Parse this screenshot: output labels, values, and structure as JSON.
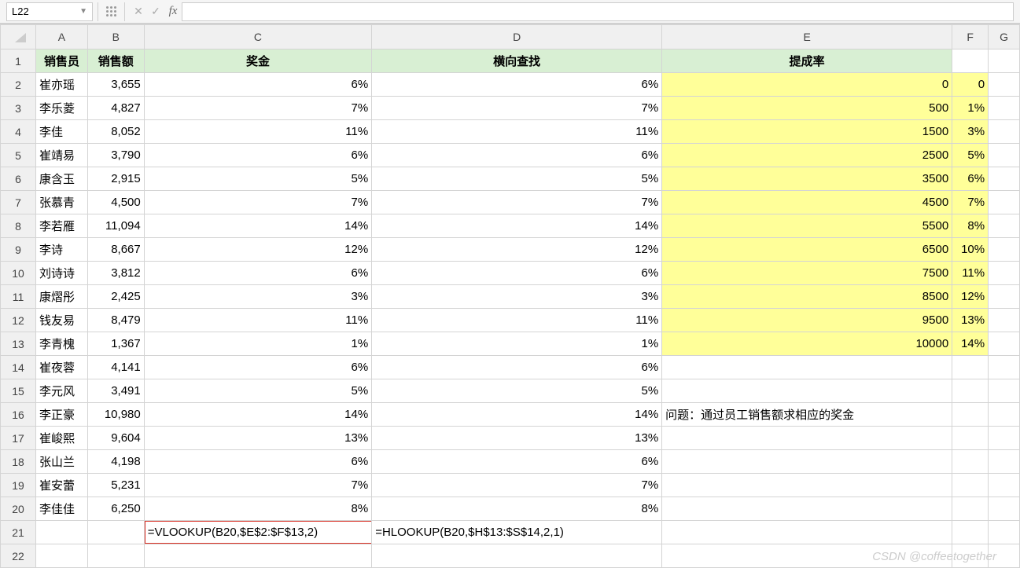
{
  "formula_bar": {
    "cell_ref": "L22",
    "formula": ""
  },
  "headers": {
    "A": "销售员",
    "B": "销售额",
    "C": "奖金",
    "D": "横向查找",
    "E": "提成率"
  },
  "rows": [
    {
      "name": "崔亦瑶",
      "sales": "3,655",
      "bonus": "6%",
      "hv": "6%",
      "e": "0",
      "f": "0"
    },
    {
      "name": "李乐菱",
      "sales": "4,827",
      "bonus": "7%",
      "hv": "7%",
      "e": "500",
      "f": "1%"
    },
    {
      "name": "李佳",
      "sales": "8,052",
      "bonus": "11%",
      "hv": "11%",
      "e": "1500",
      "f": "3%"
    },
    {
      "name": "崔靖易",
      "sales": "3,790",
      "bonus": "6%",
      "hv": "6%",
      "e": "2500",
      "f": "5%"
    },
    {
      "name": "康含玉",
      "sales": "2,915",
      "bonus": "5%",
      "hv": "5%",
      "e": "3500",
      "f": "6%"
    },
    {
      "name": "张慕青",
      "sales": "4,500",
      "bonus": "7%",
      "hv": "7%",
      "e": "4500",
      "f": "7%"
    },
    {
      "name": "李若雁",
      "sales": "11,094",
      "bonus": "14%",
      "hv": "14%",
      "e": "5500",
      "f": "8%"
    },
    {
      "name": "李诗",
      "sales": "8,667",
      "bonus": "12%",
      "hv": "12%",
      "e": "6500",
      "f": "10%"
    },
    {
      "name": "刘诗诗",
      "sales": "3,812",
      "bonus": "6%",
      "hv": "6%",
      "e": "7500",
      "f": "11%"
    },
    {
      "name": "康熠彤",
      "sales": "2,425",
      "bonus": "3%",
      "hv": "3%",
      "e": "8500",
      "f": "12%"
    },
    {
      "name": "钱友易",
      "sales": "8,479",
      "bonus": "11%",
      "hv": "11%",
      "e": "9500",
      "f": "13%"
    },
    {
      "name": "李青槐",
      "sales": "1,367",
      "bonus": "1%",
      "hv": "1%",
      "e": "10000",
      "f": "14%"
    },
    {
      "name": "崔夜蓉",
      "sales": "4,141",
      "bonus": "6%",
      "hv": "6%",
      "e": "",
      "f": ""
    },
    {
      "name": "李元风",
      "sales": "3,491",
      "bonus": "5%",
      "hv": "5%",
      "e": "",
      "f": ""
    },
    {
      "name": "李正豪",
      "sales": "10,980",
      "bonus": "14%",
      "hv": "14%",
      "e": "问题：通过员工销售额求相应的奖金",
      "f": ""
    },
    {
      "name": "崔峻熙",
      "sales": "9,604",
      "bonus": "13%",
      "hv": "13%",
      "e": "",
      "f": ""
    },
    {
      "name": "张山兰",
      "sales": "4,198",
      "bonus": "6%",
      "hv": "6%",
      "e": "",
      "f": ""
    },
    {
      "name": "崔安蕾",
      "sales": "5,231",
      "bonus": "7%",
      "hv": "7%",
      "e": "",
      "f": ""
    },
    {
      "name": "李佳佳",
      "sales": "6,250",
      "bonus": "8%",
      "hv": "8%",
      "e": "",
      "f": ""
    }
  ],
  "formula_row": {
    "c": "=VLOOKUP(B20,$E$2:$F$13,2)",
    "d": "=HLOOKUP(B20,$H$13:$S$14,2,1)"
  },
  "col_letters": [
    "A",
    "B",
    "C",
    "D",
    "E",
    "F",
    "G"
  ],
  "watermark": "CSDN @coffeetogether"
}
